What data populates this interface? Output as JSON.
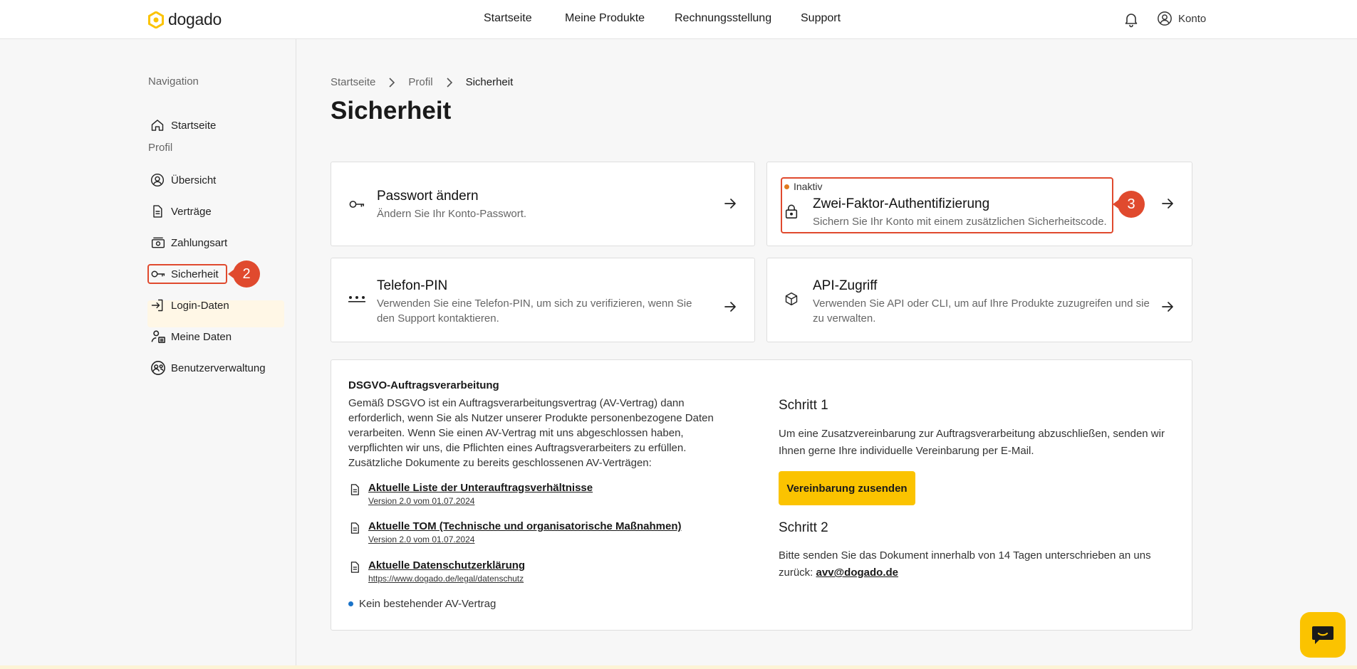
{
  "header": {
    "logo_text": "dogado",
    "nav": [
      "Startseite",
      "Meine Produkte",
      "Rechnungsstellung",
      "Support"
    ],
    "account_label": "Konto"
  },
  "sidebar": {
    "heading_navigation": "Navigation",
    "heading_profile": "Profil",
    "items": [
      {
        "label": "Startseite",
        "icon": "home-icon"
      },
      {
        "label": "Übersicht",
        "icon": "user-circle-icon"
      },
      {
        "label": "Verträge",
        "icon": "document-icon"
      },
      {
        "label": "Zahlungsart",
        "icon": "payment-icon"
      },
      {
        "label": "Sicherheit",
        "icon": "key-icon",
        "active": true
      },
      {
        "label": "Login-Daten",
        "icon": "login-icon"
      },
      {
        "label": "Meine Daten",
        "icon": "user-data-icon"
      },
      {
        "label": "Benutzerverwaltung",
        "icon": "user-management-icon"
      }
    ]
  },
  "annotations": {
    "sidebar_badge": "2",
    "card_badge": "3"
  },
  "breadcrumb": {
    "items": [
      "Startseite",
      "Profil"
    ],
    "current": "Sicherheit"
  },
  "page_title": "Sicherheit",
  "cards": {
    "password": {
      "title": "Passwort ändern",
      "desc": "Ändern Sie Ihr Konto-Passwort."
    },
    "twofa": {
      "status": "Inaktiv",
      "title": "Zwei-Faktor-Authentifizierung",
      "desc": "Sichern Sie Ihr Konto mit einem zusätzlichen Sicherheitscode."
    },
    "pin": {
      "title": "Telefon-PIN",
      "desc": "Verwenden Sie eine Telefon-PIN, um sich zu verifizieren, wenn Sie den Support kontaktieren."
    },
    "api": {
      "title": "API-Zugriff",
      "desc": "Verwenden Sie API oder CLI, um auf Ihre Produkte zuzugreifen und sie zu verwalten."
    }
  },
  "dsgvo": {
    "title": "DSGVO-Auftragsverarbeitung",
    "text": "Gemäß DSGVO ist ein Auftragsverarbeitungsvertrag (AV-Vertrag) dann erforderlich, wenn Sie als Nutzer unserer Produkte personenbezogene Daten verarbeiten. Wenn Sie einen AV-Vertrag mit uns abgeschlossen haben, verpflichten wir uns, die Pflichten eines Auftragsverarbeiters zu erfüllen.",
    "text2": "Zusätzliche Dokumente zu bereits geschlossenen AV-Verträgen:",
    "docs": [
      {
        "name": "Aktuelle Liste der Unterauftragsverhältnisse",
        "sub": "Version 2.0 vom 01.07.2024"
      },
      {
        "name": "Aktuelle TOM (Technische und organisatorische Maßnahmen)",
        "sub": "Version 2.0 vom 01.07.2024"
      },
      {
        "name": "Aktuelle Datenschutzerklärung",
        "sub": "https://www.dogado.de/legal/datenschutz"
      }
    ],
    "status": "Kein bestehender AV-Vertrag",
    "step1_title": "Schritt 1",
    "step1_text": "Um eine Zusatzvereinbarung zur Auftragsverarbeitung abzuschließen, senden wir Ihnen gerne Ihre individuelle Vereinbarung per E-Mail.",
    "button": "Vereinbarung zusenden",
    "step2_title": "Schritt 2",
    "step2_text": "Bitte senden Sie das Dokument innerhalb von 14 Tagen unterschrieben an uns zurück:",
    "email": "avv@dogado.de"
  },
  "colors": {
    "accent": "#fbc300",
    "annotation": "#e04a2e",
    "inactive_dot": "#e07a1f",
    "status_dot": "#1a73c8"
  }
}
